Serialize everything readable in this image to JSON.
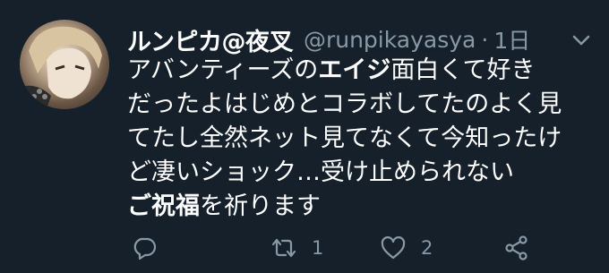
{
  "tweet": {
    "display_name": "ルンピカ@夜叉",
    "handle": "@runpikayasya",
    "separator": "·",
    "timestamp": "1日",
    "body": {
      "l1_a": "アバンティーズの",
      "l1_b": "エイジ",
      "l1_c": "面白くて好き",
      "l2": "だったよはじめとコラボしてたのよく見",
      "l3": "てたし全然ネット見てなくて今知ったけ",
      "l4": "ど凄いショック…受け止められない",
      "l5_a": "ご祝福",
      "l5_b": "を祈ります"
    },
    "actions": {
      "reply_icon": "reply-icon",
      "retweet_icon": "retweet-icon",
      "retweet_count": "1",
      "like_icon": "heart-icon",
      "like_count": "2",
      "share_icon": "share-icon"
    },
    "colors": {
      "background": "#15202b",
      "text": "#ffffff",
      "secondary": "#8899a6"
    }
  }
}
